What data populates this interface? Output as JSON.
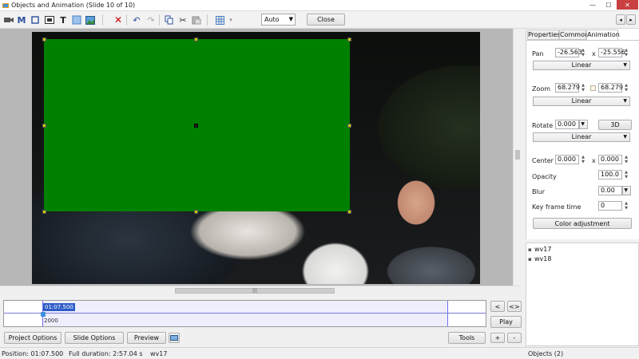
{
  "window": {
    "title": "Objects and Animation  (Slide 10 of 10)",
    "minimize": "—",
    "maximize": "☐",
    "close": "✕"
  },
  "toolbar": {
    "zoom_value": "Auto",
    "close_label": "Close",
    "nav_prev": "◂",
    "nav_next": "▸"
  },
  "timeline": {
    "current_time": "01:07.500",
    "dash": "-",
    "duration_ms": "2000"
  },
  "timeline_buttons": {
    "prev": "<",
    "next": "<>",
    "play": "Play",
    "add": "+",
    "remove": "-"
  },
  "bottom_buttons": {
    "project_options": "Project Options",
    "slide_options": "Slide Options",
    "preview": "Preview",
    "tools": "Tools"
  },
  "panel": {
    "tabs": [
      "Properties",
      "Common",
      "Animation"
    ],
    "pan_label": "Pan",
    "pan_x": "-26.563",
    "pan_y": "-25.556",
    "x_sep": "x",
    "pan_interp": "Linear",
    "zoom_label": "Zoom",
    "zoom_x": "68.279",
    "zoom_y": "68.279",
    "zoom_interp": "Linear",
    "rotate_label": "Rotate",
    "rotate_value": "0.000",
    "btn_3d": "3D",
    "rotate_interp": "Linear",
    "center_label": "Center",
    "center_x": "0.000",
    "center_y": "0.000",
    "opacity_label": "Opacity",
    "opacity_value": "100.0",
    "blur_label": "Blur",
    "blur_value": "0.00",
    "keyframe_label": "Key frame time",
    "keyframe_value": "0",
    "color_adjust": "Color adjustment"
  },
  "objects": [
    "wv17",
    "wv18"
  ],
  "status": {
    "position": "Position:  01:07.500",
    "duration": "Full duration:  2:57.04 s",
    "object": "wv17",
    "objects_count": "Objects (2)"
  },
  "colors": {
    "accent": "#2e5cc8",
    "green_object": "#008000",
    "close_red": "#c84040"
  }
}
